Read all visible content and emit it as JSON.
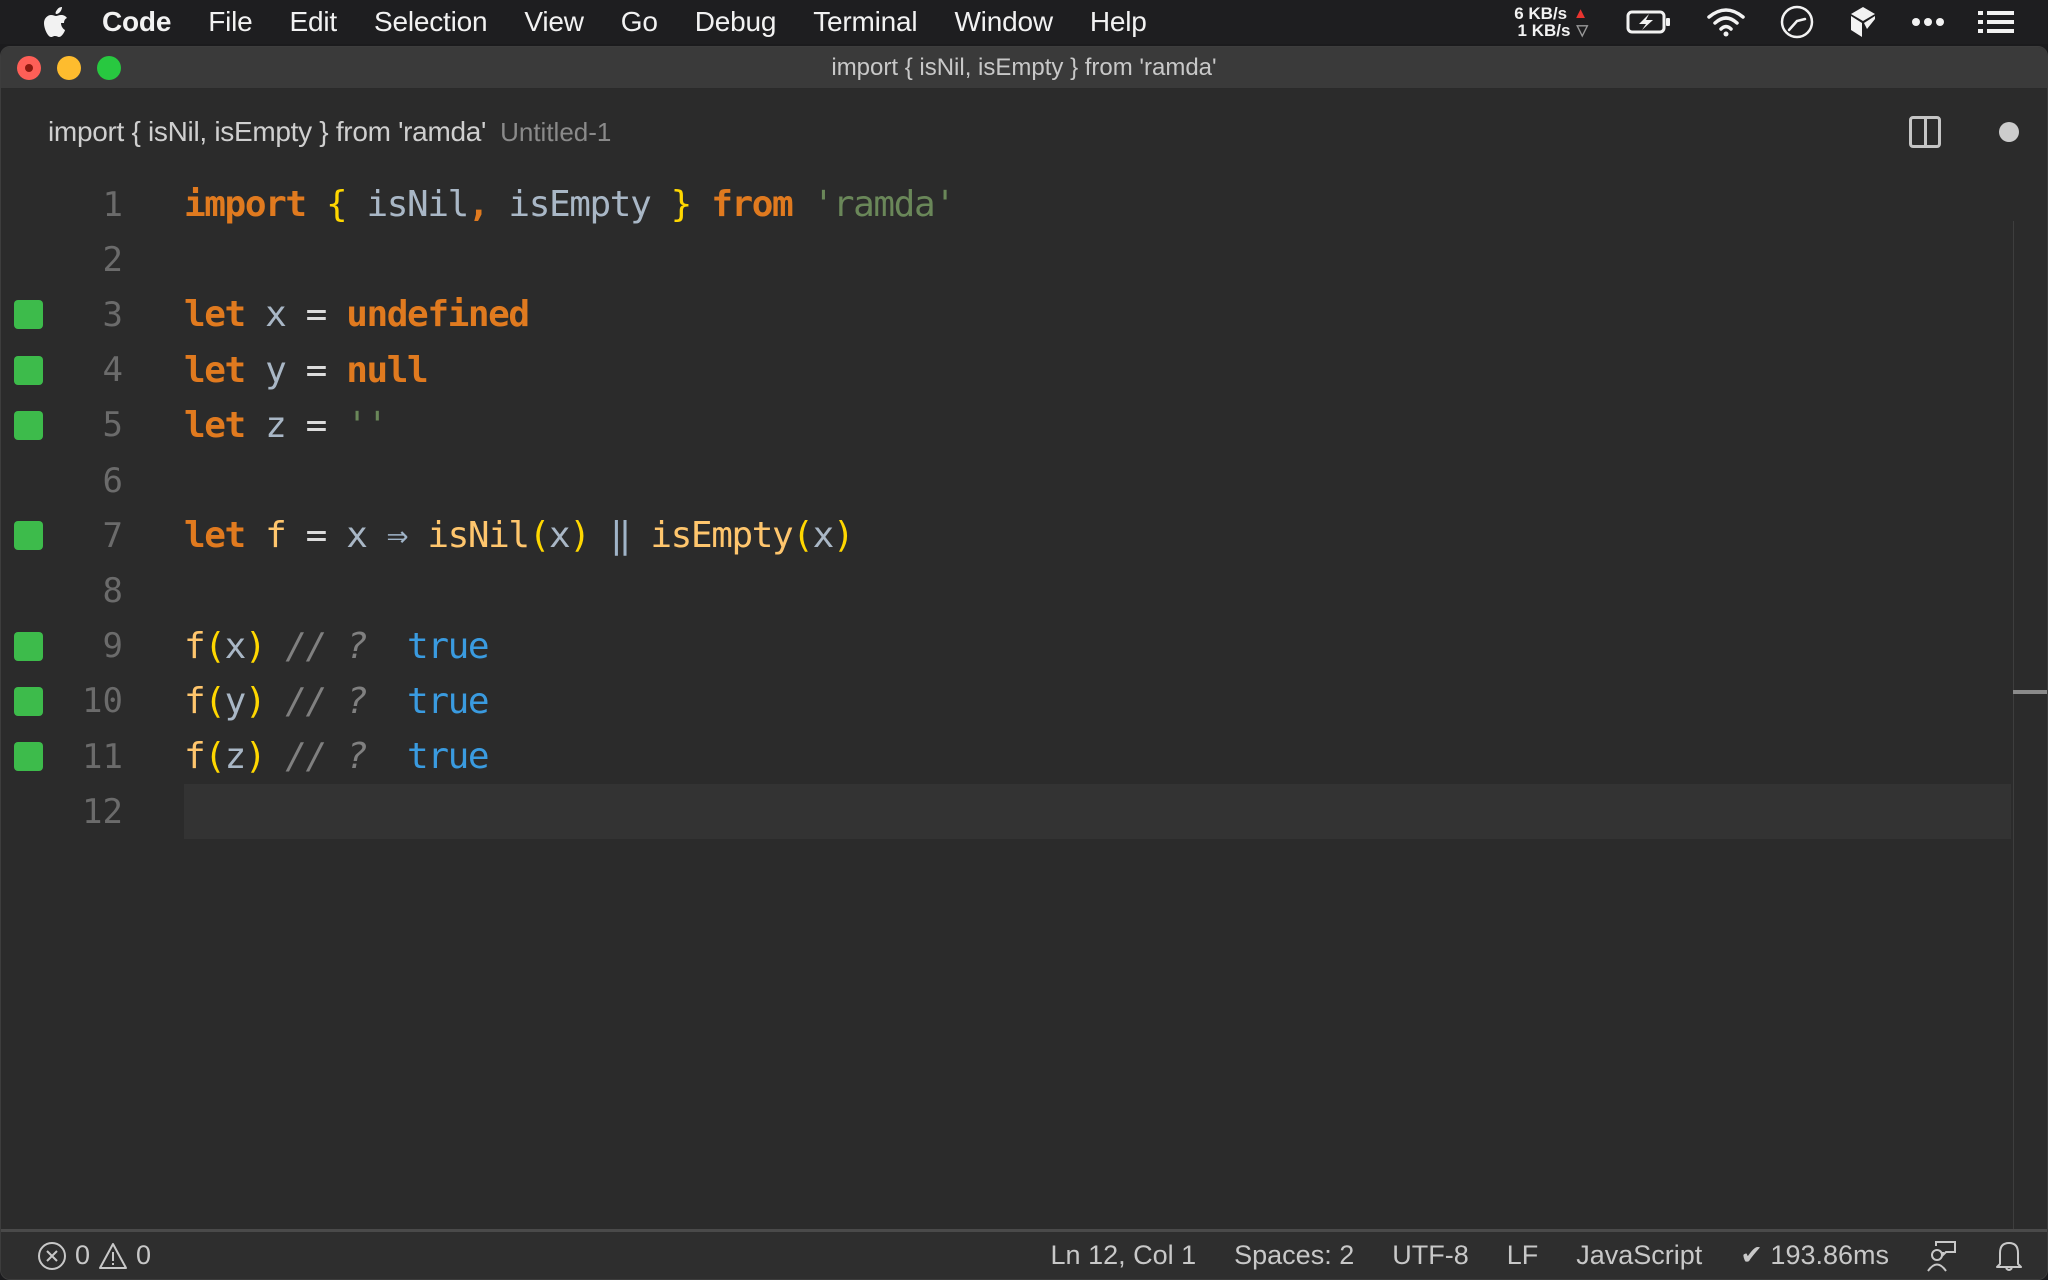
{
  "menubar": {
    "apple_icon": "apple-logo-icon",
    "items": [
      "Code",
      "File",
      "Edit",
      "Selection",
      "View",
      "Go",
      "Debug",
      "Terminal",
      "Window",
      "Help"
    ],
    "network": {
      "upload": "6 KB/s",
      "download": "1 KB/s"
    },
    "tray_icons": [
      "battery-charging-icon",
      "wifi-icon",
      "clock-icon",
      "app-cube-icon",
      "more-dots-icon",
      "list-icon"
    ]
  },
  "window": {
    "title": "import { isNil, isEmpty } from 'ramda'"
  },
  "tab": {
    "label": "import { isNil, isEmpty } from 'ramda'",
    "description": "Untitled-1",
    "split_icon": "split-editor-icon",
    "dirty_icon": "unsaved-dot-icon"
  },
  "editor": {
    "current_line": 12,
    "lines": [
      {
        "number": "1",
        "marker": false,
        "tokens": [
          {
            "t": "import",
            "c": "kw"
          },
          {
            "t": " ",
            "c": "op"
          },
          {
            "t": "{",
            "c": "brace"
          },
          {
            "t": " isNil",
            "c": "id"
          },
          {
            "t": ",",
            "c": "kw"
          },
          {
            "t": " isEmpty ",
            "c": "id"
          },
          {
            "t": "}",
            "c": "brace"
          },
          {
            "t": " ",
            "c": "op"
          },
          {
            "t": "from",
            "c": "kw"
          },
          {
            "t": " ",
            "c": "op"
          },
          {
            "t": "'ramda'",
            "c": "str"
          }
        ]
      },
      {
        "number": "2",
        "marker": false,
        "tokens": []
      },
      {
        "number": "3",
        "marker": true,
        "tokens": [
          {
            "t": "let",
            "c": "kw"
          },
          {
            "t": " x ",
            "c": "id"
          },
          {
            "t": "=",
            "c": "op"
          },
          {
            "t": " ",
            "c": "op"
          },
          {
            "t": "undefined",
            "c": "kw"
          }
        ]
      },
      {
        "number": "4",
        "marker": true,
        "tokens": [
          {
            "t": "let",
            "c": "kw"
          },
          {
            "t": " y ",
            "c": "id"
          },
          {
            "t": "=",
            "c": "op"
          },
          {
            "t": " ",
            "c": "op"
          },
          {
            "t": "null",
            "c": "kw"
          }
        ]
      },
      {
        "number": "5",
        "marker": true,
        "tokens": [
          {
            "t": "let",
            "c": "kw"
          },
          {
            "t": " z ",
            "c": "id"
          },
          {
            "t": "=",
            "c": "op"
          },
          {
            "t": " ",
            "c": "op"
          },
          {
            "t": "''",
            "c": "str"
          }
        ]
      },
      {
        "number": "6",
        "marker": false,
        "tokens": []
      },
      {
        "number": "7",
        "marker": true,
        "tokens": [
          {
            "t": "let",
            "c": "kw"
          },
          {
            "t": " f ",
            "c": "fn"
          },
          {
            "t": "=",
            "c": "op"
          },
          {
            "t": " x ",
            "c": "id"
          },
          {
            "t": "⇒",
            "c": "arrow"
          },
          {
            "t": " isNil",
            "c": "fn"
          },
          {
            "t": "(",
            "c": "brace"
          },
          {
            "t": "x",
            "c": "id"
          },
          {
            "t": ")",
            "c": "brace"
          },
          {
            "t": " ‖ ",
            "c": "arrow"
          },
          {
            "t": "isEmpty",
            "c": "fn"
          },
          {
            "t": "(",
            "c": "brace"
          },
          {
            "t": "x",
            "c": "id"
          },
          {
            "t": ")",
            "c": "brace"
          }
        ]
      },
      {
        "number": "8",
        "marker": false,
        "tokens": []
      },
      {
        "number": "9",
        "marker": true,
        "tokens": [
          {
            "t": "f",
            "c": "fn"
          },
          {
            "t": "(",
            "c": "brace"
          },
          {
            "t": "x",
            "c": "id"
          },
          {
            "t": ")",
            "c": "brace"
          },
          {
            "t": " // ? ",
            "c": "cmt"
          },
          {
            "t": " true",
            "c": "val"
          }
        ]
      },
      {
        "number": "10",
        "marker": true,
        "tokens": [
          {
            "t": "f",
            "c": "fn"
          },
          {
            "t": "(",
            "c": "brace"
          },
          {
            "t": "y",
            "c": "id"
          },
          {
            "t": ")",
            "c": "brace"
          },
          {
            "t": " // ? ",
            "c": "cmt"
          },
          {
            "t": " true",
            "c": "val"
          }
        ]
      },
      {
        "number": "11",
        "marker": true,
        "tokens": [
          {
            "t": "f",
            "c": "fn"
          },
          {
            "t": "(",
            "c": "brace"
          },
          {
            "t": "z",
            "c": "id"
          },
          {
            "t": ")",
            "c": "brace"
          },
          {
            "t": " // ? ",
            "c": "cmt"
          },
          {
            "t": " true",
            "c": "val"
          }
        ]
      },
      {
        "number": "12",
        "marker": false,
        "tokens": []
      }
    ]
  },
  "statusbar": {
    "errors": "0",
    "warnings": "0",
    "position": "Ln 12, Col 1",
    "indent": "Spaces: 2",
    "encoding": "UTF-8",
    "eol": "LF",
    "language": "JavaScript",
    "timing": "✔ 193.86ms",
    "feedback_icon": "feedback-person-icon",
    "bell_icon": "notifications-bell-icon"
  },
  "colors": {
    "coverage_marker": "#3dbb4b",
    "keyword": "#e07a1f",
    "identifier": "#a9b7c6",
    "function": "#ffc66d",
    "brace": "#ffd700",
    "string": "#6a8759",
    "value": "#3a9be0",
    "comment": "#808080"
  }
}
